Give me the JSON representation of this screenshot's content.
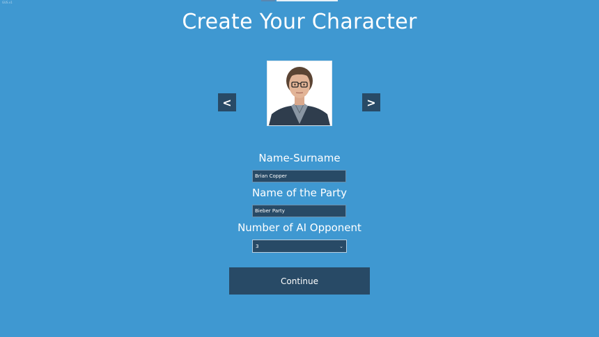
{
  "window": {
    "corner_label": "GUS.v1"
  },
  "header": {
    "title": "Create Your Character"
  },
  "portrait_nav": {
    "prev_label": "<",
    "next_label": ">"
  },
  "form": {
    "name_label": "Name-Surname",
    "name_value": "Brian Copper",
    "party_label": "Name of the Party",
    "party_value": "Bieber Party",
    "opponents_label": "Number of AI Opponent",
    "opponents_value": "3"
  },
  "actions": {
    "continue_label": "Continue"
  },
  "icons": {
    "dropdown": "chevron-down-icon",
    "portrait": "character-portrait"
  },
  "colors": {
    "background": "#3f98d1",
    "panel": "#284a66",
    "text": "#ffffff"
  }
}
